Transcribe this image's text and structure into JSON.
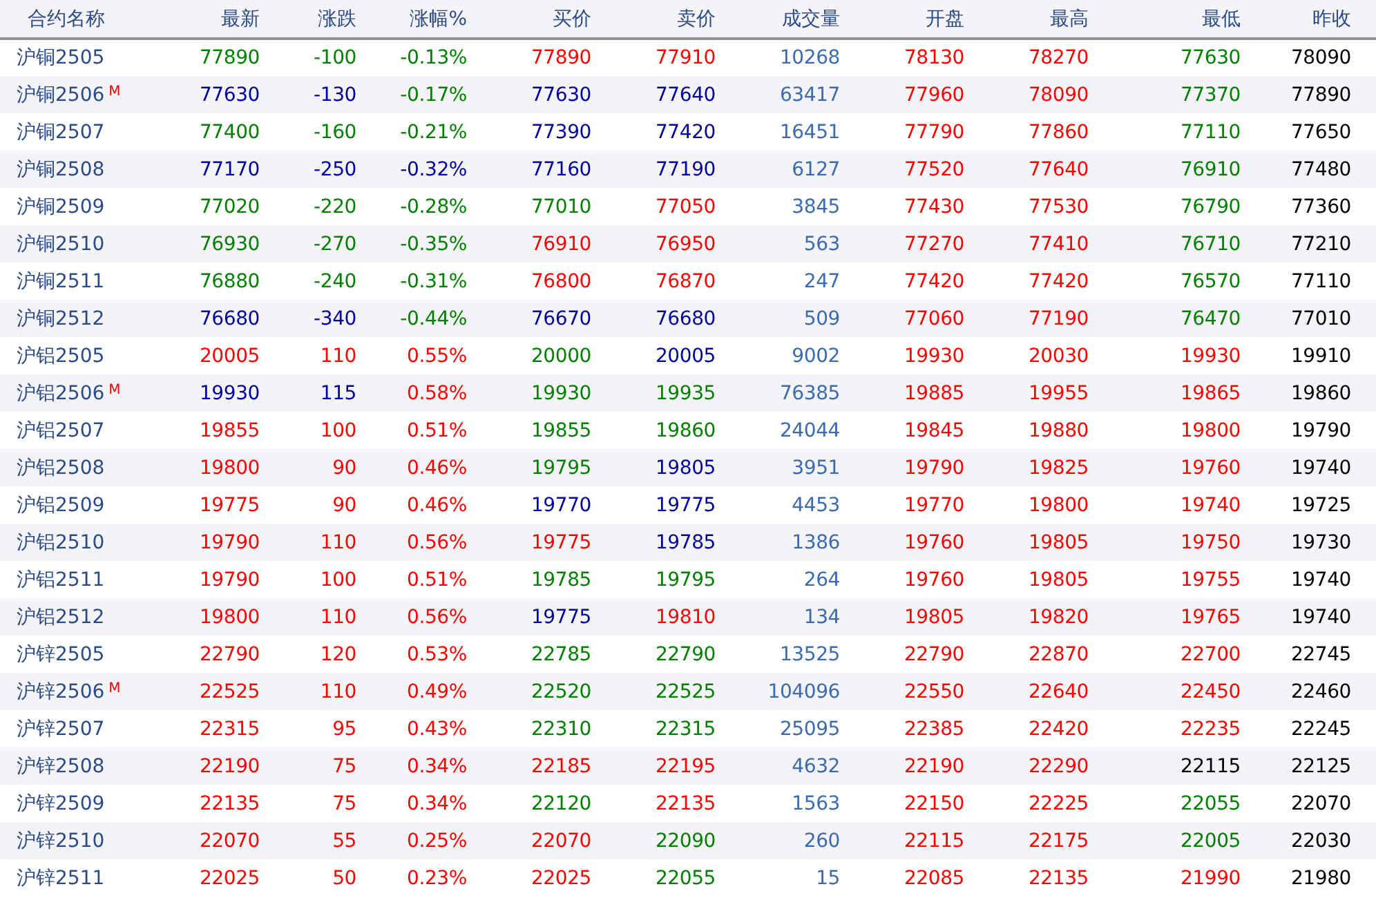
{
  "table": {
    "columns": [
      "合约名称",
      "最新",
      "涨跌",
      "涨幅%",
      "买价",
      "卖价",
      "成交量",
      "开盘",
      "最高",
      "最低",
      "昨收"
    ],
    "rows": [
      {
        "cells": [
          {
            "text": "沪铜2505"
          },
          {
            "text": "77890",
            "color": "#008000"
          },
          {
            "text": "-100",
            "color": "#008000"
          },
          {
            "text": "-0.13%",
            "color": "#008000"
          },
          {
            "text": "77890",
            "color": "#ff0000"
          },
          {
            "text": "77910",
            "color": "#ff0000"
          },
          {
            "text": "10268"
          },
          {
            "text": "78130",
            "color": "#ff0000"
          },
          {
            "text": "78270",
            "color": "#ff0000"
          },
          {
            "text": "77630",
            "color": "#008000"
          },
          {
            "text": "78090"
          }
        ]
      },
      {
        "cells": [
          {
            "text": "沪铜2506",
            "badge": "M"
          },
          {
            "text": "77630",
            "color": "#0000a0"
          },
          {
            "text": "-130",
            "color": "#0000a0"
          },
          {
            "text": "-0.17%",
            "color": "#008000"
          },
          {
            "text": "77630",
            "color": "#0000a0"
          },
          {
            "text": "77640",
            "color": "#0000a0"
          },
          {
            "text": "63417"
          },
          {
            "text": "77960",
            "color": "#ff0000"
          },
          {
            "text": "78090",
            "color": "#ff0000"
          },
          {
            "text": "77370",
            "color": "#008000"
          },
          {
            "text": "77890"
          }
        ]
      },
      {
        "cells": [
          {
            "text": "沪铜2507"
          },
          {
            "text": "77400",
            "color": "#008000"
          },
          {
            "text": "-160",
            "color": "#008000"
          },
          {
            "text": "-0.21%",
            "color": "#008000"
          },
          {
            "text": "77390",
            "color": "#0000a0"
          },
          {
            "text": "77420",
            "color": "#0000a0"
          },
          {
            "text": "16451"
          },
          {
            "text": "77790",
            "color": "#ff0000"
          },
          {
            "text": "77860",
            "color": "#ff0000"
          },
          {
            "text": "77110",
            "color": "#008000"
          },
          {
            "text": "77650"
          }
        ]
      },
      {
        "cells": [
          {
            "text": "沪铜2508"
          },
          {
            "text": "77170",
            "color": "#0000a0"
          },
          {
            "text": "-250",
            "color": "#0000a0"
          },
          {
            "text": "-0.32%",
            "color": "#0000a0"
          },
          {
            "text": "77160",
            "color": "#0000a0"
          },
          {
            "text": "77190",
            "color": "#0000a0"
          },
          {
            "text": "6127"
          },
          {
            "text": "77520",
            "color": "#ff0000"
          },
          {
            "text": "77640",
            "color": "#ff0000"
          },
          {
            "text": "76910",
            "color": "#008000"
          },
          {
            "text": "77480"
          }
        ]
      },
      {
        "cells": [
          {
            "text": "沪铜2509"
          },
          {
            "text": "77020",
            "color": "#008000"
          },
          {
            "text": "-220",
            "color": "#008000"
          },
          {
            "text": "-0.28%",
            "color": "#008000"
          },
          {
            "text": "77010",
            "color": "#008000"
          },
          {
            "text": "77050",
            "color": "#ff0000"
          },
          {
            "text": "3845"
          },
          {
            "text": "77430",
            "color": "#ff0000"
          },
          {
            "text": "77530",
            "color": "#ff0000"
          },
          {
            "text": "76790",
            "color": "#008000"
          },
          {
            "text": "77360"
          }
        ]
      },
      {
        "cells": [
          {
            "text": "沪铜2510"
          },
          {
            "text": "76930",
            "color": "#008000"
          },
          {
            "text": "-270",
            "color": "#008000"
          },
          {
            "text": "-0.35%",
            "color": "#008000"
          },
          {
            "text": "76910",
            "color": "#ff0000"
          },
          {
            "text": "76950",
            "color": "#ff0000"
          },
          {
            "text": "563"
          },
          {
            "text": "77270",
            "color": "#ff0000"
          },
          {
            "text": "77410",
            "color": "#ff0000"
          },
          {
            "text": "76710",
            "color": "#008000"
          },
          {
            "text": "77210"
          }
        ]
      },
      {
        "cells": [
          {
            "text": "沪铜2511"
          },
          {
            "text": "76880",
            "color": "#008000"
          },
          {
            "text": "-240",
            "color": "#008000"
          },
          {
            "text": "-0.31%",
            "color": "#008000"
          },
          {
            "text": "76800",
            "color": "#ff0000"
          },
          {
            "text": "76870",
            "color": "#ff0000"
          },
          {
            "text": "247"
          },
          {
            "text": "77420",
            "color": "#ff0000"
          },
          {
            "text": "77420",
            "color": "#ff0000"
          },
          {
            "text": "76570",
            "color": "#008000"
          },
          {
            "text": "77110"
          }
        ]
      },
      {
        "cells": [
          {
            "text": "沪铜2512"
          },
          {
            "text": "76680",
            "color": "#0000a0"
          },
          {
            "text": "-340",
            "color": "#0000a0"
          },
          {
            "text": "-0.44%",
            "color": "#008000"
          },
          {
            "text": "76670",
            "color": "#0000a0"
          },
          {
            "text": "76680",
            "color": "#0000a0"
          },
          {
            "text": "509"
          },
          {
            "text": "77060",
            "color": "#ff0000"
          },
          {
            "text": "77190",
            "color": "#ff0000"
          },
          {
            "text": "76470",
            "color": "#008000"
          },
          {
            "text": "77010"
          }
        ]
      },
      {
        "cells": [
          {
            "text": "沪铝2505"
          },
          {
            "text": "20005",
            "color": "#ff0000"
          },
          {
            "text": "110",
            "color": "#ff0000"
          },
          {
            "text": "0.55%",
            "color": "#ff0000"
          },
          {
            "text": "20000",
            "color": "#008000"
          },
          {
            "text": "20005",
            "color": "#0000a0"
          },
          {
            "text": "9002"
          },
          {
            "text": "19930",
            "color": "#ff0000"
          },
          {
            "text": "20030",
            "color": "#ff0000"
          },
          {
            "text": "19930",
            "color": "#ff0000"
          },
          {
            "text": "19910"
          }
        ]
      },
      {
        "cells": [
          {
            "text": "沪铝2506",
            "badge": "M"
          },
          {
            "text": "19930",
            "color": "#0000a0"
          },
          {
            "text": "115",
            "color": "#0000a0"
          },
          {
            "text": "0.58%",
            "color": "#ff0000"
          },
          {
            "text": "19930",
            "color": "#008000"
          },
          {
            "text": "19935",
            "color": "#008000"
          },
          {
            "text": "76385"
          },
          {
            "text": "19885",
            "color": "#ff0000"
          },
          {
            "text": "19955",
            "color": "#ff0000"
          },
          {
            "text": "19865",
            "color": "#ff0000"
          },
          {
            "text": "19860"
          }
        ]
      },
      {
        "cells": [
          {
            "text": "沪铝2507"
          },
          {
            "text": "19855",
            "color": "#ff0000"
          },
          {
            "text": "100",
            "color": "#ff0000"
          },
          {
            "text": "0.51%",
            "color": "#ff0000"
          },
          {
            "text": "19855",
            "color": "#008000"
          },
          {
            "text": "19860",
            "color": "#008000"
          },
          {
            "text": "24044"
          },
          {
            "text": "19845",
            "color": "#ff0000"
          },
          {
            "text": "19880",
            "color": "#ff0000"
          },
          {
            "text": "19800",
            "color": "#ff0000"
          },
          {
            "text": "19790"
          }
        ]
      },
      {
        "cells": [
          {
            "text": "沪铝2508"
          },
          {
            "text": "19800",
            "color": "#ff0000"
          },
          {
            "text": "90",
            "color": "#ff0000"
          },
          {
            "text": "0.46%",
            "color": "#ff0000"
          },
          {
            "text": "19795",
            "color": "#008000"
          },
          {
            "text": "19805",
            "color": "#0000a0"
          },
          {
            "text": "3951"
          },
          {
            "text": "19790",
            "color": "#ff0000"
          },
          {
            "text": "19825",
            "color": "#ff0000"
          },
          {
            "text": "19760",
            "color": "#ff0000"
          },
          {
            "text": "19740"
          }
        ]
      },
      {
        "cells": [
          {
            "text": "沪铝2509"
          },
          {
            "text": "19775",
            "color": "#ff0000"
          },
          {
            "text": "90",
            "color": "#ff0000"
          },
          {
            "text": "0.46%",
            "color": "#ff0000"
          },
          {
            "text": "19770",
            "color": "#0000a0"
          },
          {
            "text": "19775",
            "color": "#0000a0"
          },
          {
            "text": "4453"
          },
          {
            "text": "19770",
            "color": "#ff0000"
          },
          {
            "text": "19800",
            "color": "#ff0000"
          },
          {
            "text": "19740",
            "color": "#ff0000"
          },
          {
            "text": "19725"
          }
        ]
      },
      {
        "cells": [
          {
            "text": "沪铝2510"
          },
          {
            "text": "19790",
            "color": "#ff0000"
          },
          {
            "text": "110",
            "color": "#ff0000"
          },
          {
            "text": "0.56%",
            "color": "#ff0000"
          },
          {
            "text": "19775",
            "color": "#ff0000"
          },
          {
            "text": "19785",
            "color": "#0000a0"
          },
          {
            "text": "1386"
          },
          {
            "text": "19760",
            "color": "#ff0000"
          },
          {
            "text": "19805",
            "color": "#ff0000"
          },
          {
            "text": "19750",
            "color": "#ff0000"
          },
          {
            "text": "19730"
          }
        ]
      },
      {
        "cells": [
          {
            "text": "沪铝2511"
          },
          {
            "text": "19790",
            "color": "#ff0000"
          },
          {
            "text": "100",
            "color": "#ff0000"
          },
          {
            "text": "0.51%",
            "color": "#ff0000"
          },
          {
            "text": "19785",
            "color": "#008000"
          },
          {
            "text": "19795",
            "color": "#008000"
          },
          {
            "text": "264"
          },
          {
            "text": "19760",
            "color": "#ff0000"
          },
          {
            "text": "19805",
            "color": "#ff0000"
          },
          {
            "text": "19755",
            "color": "#ff0000"
          },
          {
            "text": "19740"
          }
        ]
      },
      {
        "cells": [
          {
            "text": "沪铝2512"
          },
          {
            "text": "19800",
            "color": "#ff0000"
          },
          {
            "text": "110",
            "color": "#ff0000"
          },
          {
            "text": "0.56%",
            "color": "#ff0000"
          },
          {
            "text": "19775",
            "color": "#0000a0"
          },
          {
            "text": "19810",
            "color": "#ff0000"
          },
          {
            "text": "134"
          },
          {
            "text": "19805",
            "color": "#ff0000"
          },
          {
            "text": "19820",
            "color": "#ff0000"
          },
          {
            "text": "19765",
            "color": "#ff0000"
          },
          {
            "text": "19740"
          }
        ]
      },
      {
        "cells": [
          {
            "text": "沪锌2505"
          },
          {
            "text": "22790",
            "color": "#ff0000"
          },
          {
            "text": "120",
            "color": "#ff0000"
          },
          {
            "text": "0.53%",
            "color": "#ff0000"
          },
          {
            "text": "22785",
            "color": "#008000"
          },
          {
            "text": "22790",
            "color": "#008000"
          },
          {
            "text": "13525"
          },
          {
            "text": "22790",
            "color": "#ff0000"
          },
          {
            "text": "22870",
            "color": "#ff0000"
          },
          {
            "text": "22700",
            "color": "#ff0000"
          },
          {
            "text": "22745"
          }
        ]
      },
      {
        "cells": [
          {
            "text": "沪锌2506",
            "badge": "M"
          },
          {
            "text": "22525",
            "color": "#ff0000"
          },
          {
            "text": "110",
            "color": "#ff0000"
          },
          {
            "text": "0.49%",
            "color": "#ff0000"
          },
          {
            "text": "22520",
            "color": "#008000"
          },
          {
            "text": "22525",
            "color": "#008000"
          },
          {
            "text": "104096"
          },
          {
            "text": "22550",
            "color": "#ff0000"
          },
          {
            "text": "22640",
            "color": "#ff0000"
          },
          {
            "text": "22450",
            "color": "#ff0000"
          },
          {
            "text": "22460"
          }
        ]
      },
      {
        "cells": [
          {
            "text": "沪锌2507"
          },
          {
            "text": "22315",
            "color": "#ff0000"
          },
          {
            "text": "95",
            "color": "#ff0000"
          },
          {
            "text": "0.43%",
            "color": "#ff0000"
          },
          {
            "text": "22310",
            "color": "#008000"
          },
          {
            "text": "22315",
            "color": "#008000"
          },
          {
            "text": "25095"
          },
          {
            "text": "22385",
            "color": "#ff0000"
          },
          {
            "text": "22420",
            "color": "#ff0000"
          },
          {
            "text": "22235",
            "color": "#ff0000"
          },
          {
            "text": "22245"
          }
        ]
      },
      {
        "cells": [
          {
            "text": "沪锌2508"
          },
          {
            "text": "22190",
            "color": "#ff0000"
          },
          {
            "text": "75",
            "color": "#ff0000"
          },
          {
            "text": "0.34%",
            "color": "#ff0000"
          },
          {
            "text": "22185",
            "color": "#ff0000"
          },
          {
            "text": "22195",
            "color": "#ff0000"
          },
          {
            "text": "4632"
          },
          {
            "text": "22190",
            "color": "#ff0000"
          },
          {
            "text": "22290",
            "color": "#ff0000"
          },
          {
            "text": "22115",
            "color": "#000000"
          },
          {
            "text": "22125"
          }
        ]
      },
      {
        "cells": [
          {
            "text": "沪锌2509"
          },
          {
            "text": "22135",
            "color": "#ff0000"
          },
          {
            "text": "75",
            "color": "#ff0000"
          },
          {
            "text": "0.34%",
            "color": "#ff0000"
          },
          {
            "text": "22120",
            "color": "#008000"
          },
          {
            "text": "22135",
            "color": "#ff0000"
          },
          {
            "text": "1563"
          },
          {
            "text": "22150",
            "color": "#ff0000"
          },
          {
            "text": "22225",
            "color": "#ff0000"
          },
          {
            "text": "22055",
            "color": "#008000"
          },
          {
            "text": "22070"
          }
        ]
      },
      {
        "cells": [
          {
            "text": "沪锌2510"
          },
          {
            "text": "22070",
            "color": "#ff0000"
          },
          {
            "text": "55",
            "color": "#ff0000"
          },
          {
            "text": "0.25%",
            "color": "#ff0000"
          },
          {
            "text": "22070",
            "color": "#ff0000"
          },
          {
            "text": "22090",
            "color": "#008000"
          },
          {
            "text": "260"
          },
          {
            "text": "22115",
            "color": "#ff0000"
          },
          {
            "text": "22175",
            "color": "#ff0000"
          },
          {
            "text": "22005",
            "color": "#008000"
          },
          {
            "text": "22030"
          }
        ]
      },
      {
        "cells": [
          {
            "text": "沪锌2511"
          },
          {
            "text": "22025",
            "color": "#ff0000"
          },
          {
            "text": "50",
            "color": "#ff0000"
          },
          {
            "text": "0.23%",
            "color": "#ff0000"
          },
          {
            "text": "22025",
            "color": "#ff0000"
          },
          {
            "text": "22055",
            "color": "#008000"
          },
          {
            "text": "15"
          },
          {
            "text": "22085",
            "color": "#ff0000"
          },
          {
            "text": "22135",
            "color": "#ff0000"
          },
          {
            "text": "21990",
            "color": "#ff0000"
          },
          {
            "text": "21980"
          }
        ]
      }
    ]
  }
}
